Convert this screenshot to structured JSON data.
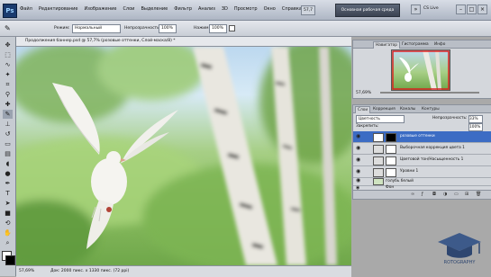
{
  "app": {
    "logo": "Ps"
  },
  "menu": [
    "Файл",
    "Редактирование",
    "Изображение",
    "Слои",
    "Выделение",
    "Фильтр",
    "Анализ",
    "3D",
    "Просмотр",
    "Окно",
    "Справка"
  ],
  "titlebar": {
    "zoom": "57,7",
    "workspace_button": "Основная рабочая среда",
    "cslive": "CS Live"
  },
  "options": {
    "mode_label": "Режим:",
    "mode_value": "Нормальный",
    "opacity_label": "Непрозрачность:",
    "opacity_value": "100%",
    "press_label": "Нажим:",
    "press_value": "100%"
  },
  "document": {
    "tab_title": "Продолжения баннер.psd @ 57,7% (розовые оттенки, Слой-маска/8) *",
    "status_zoom": "57,69%",
    "status_doc": "Док: 2000 пикс. x 1330 пикс. (72 ppi)"
  },
  "navigator": {
    "tabs": [
      "Навигатор",
      "Гистограмма",
      "Инфо"
    ],
    "zoom": "57,69%"
  },
  "layers": {
    "tabs": [
      "Слои",
      "Коррекция",
      "Каналы",
      "Контуры"
    ],
    "blend_mode": "Цветность",
    "opacity_label": "Непрозрачность:",
    "opacity": "33%",
    "fill_label": "Закрепить:",
    "fill": "100%",
    "items": [
      {
        "name": "розовые оттенки",
        "selected": true
      },
      {
        "name": "Выборочная коррекция цвета 1",
        "selected": false
      },
      {
        "name": "Цветовой тон/Насыщенность 1",
        "selected": false
      },
      {
        "name": "Уровни 1",
        "selected": false
      },
      {
        "name": "голубь белый",
        "selected": false
      },
      {
        "name": "Фон",
        "selected": false
      }
    ]
  },
  "watermark": "ROTOGRAPHY",
  "colors": {
    "accent": "#3c6cc4",
    "canvas_green": "#8dbf63",
    "sky": "#bcd8ef"
  },
  "icons": [
    "brush-icon",
    "move-icon",
    "marquee-icon",
    "lasso-icon",
    "crop-icon",
    "eyedropper-icon",
    "heal-icon",
    "stamp-icon",
    "eraser-icon",
    "gradient-icon",
    "pen-icon",
    "type-icon",
    "hand-icon",
    "zoom-icon",
    "eye-icon"
  ]
}
